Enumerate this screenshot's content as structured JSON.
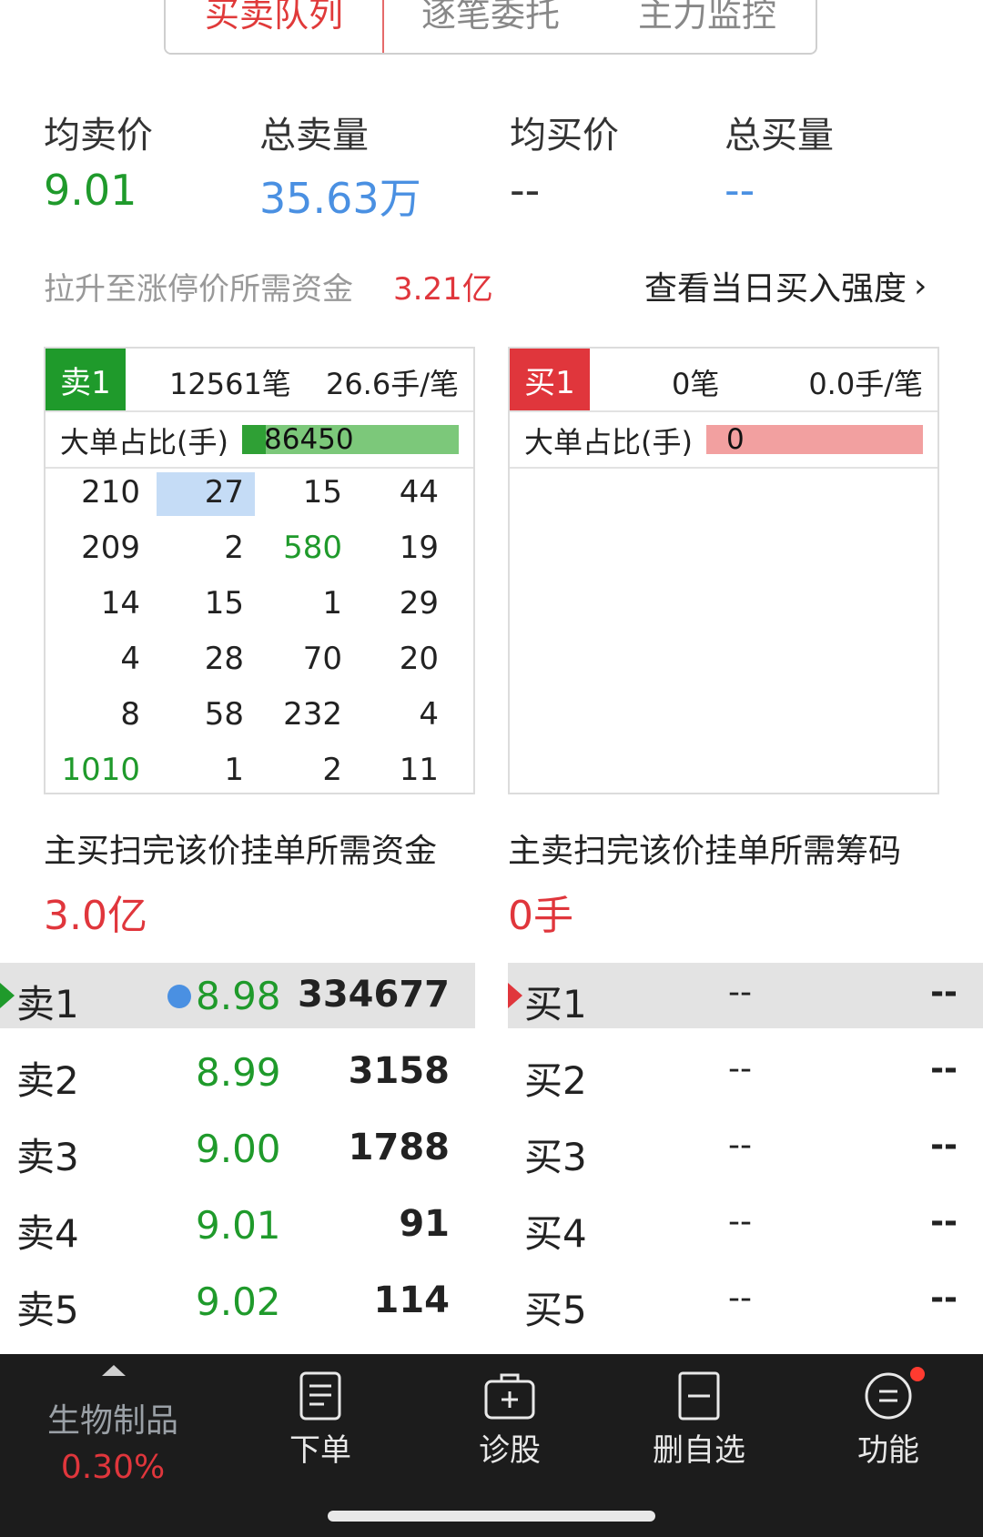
{
  "tabs": [
    "买卖队列",
    "逐笔委托",
    "主力监控"
  ],
  "summary": {
    "avg_sell_label": "均卖价",
    "avg_sell_value": "9.01",
    "total_sell_label": "总卖量",
    "total_sell_value": "35.63万",
    "avg_buy_label": "均买价",
    "avg_buy_value": "--",
    "total_buy_label": "总买量",
    "total_buy_value": "--"
  },
  "limit_up": {
    "label": "拉升至涨停价所需资金",
    "value": "3.21亿",
    "link": "查看当日买入强度"
  },
  "sell_queue": {
    "badge": "卖1",
    "orders": "12561笔",
    "avg": "26.6手/笔",
    "big_label": "大单占比(手)",
    "big_value": "86450",
    "rows": [
      [
        "210",
        "27",
        "15",
        "44"
      ],
      [
        "209",
        "2",
        "580",
        "19"
      ],
      [
        "14",
        "15",
        "1",
        "29"
      ],
      [
        "4",
        "28",
        "70",
        "20"
      ],
      [
        "8",
        "58",
        "232",
        "4"
      ],
      [
        "1010",
        "1",
        "2",
        "11"
      ]
    ],
    "footer_label": "主买扫完该价挂单所需资金",
    "footer_value": "3.0亿"
  },
  "buy_queue": {
    "badge": "买1",
    "orders": "0笔",
    "avg": "0.0手/笔",
    "big_label": "大单占比(手)",
    "big_value": "0",
    "footer_label": "主卖扫完该价挂单所需筹码",
    "footer_value": "0手"
  },
  "asks": [
    {
      "label": "卖1",
      "price": "8.98",
      "vol": "334677"
    },
    {
      "label": "卖2",
      "price": "8.99",
      "vol": "3158"
    },
    {
      "label": "卖3",
      "price": "9.00",
      "vol": "1788"
    },
    {
      "label": "卖4",
      "price": "9.01",
      "vol": "91"
    },
    {
      "label": "卖5",
      "price": "9.02",
      "vol": "114"
    }
  ],
  "bids": [
    {
      "label": "买1",
      "price": "--",
      "vol": "--"
    },
    {
      "label": "买2",
      "price": "--",
      "vol": "--"
    },
    {
      "label": "买3",
      "price": "--",
      "vol": "--"
    },
    {
      "label": "买4",
      "price": "--",
      "vol": "--"
    },
    {
      "label": "买5",
      "price": "--",
      "vol": "--"
    }
  ],
  "nav": {
    "sector_name": "生物制品",
    "sector_change": "0.30%",
    "order": "下单",
    "diagnose": "诊股",
    "remove_watch": "删自选",
    "function": "功能"
  },
  "colors": {
    "up": "#e0363c",
    "down": "#1f9a2b",
    "accent_blue": "#4a90e2"
  }
}
